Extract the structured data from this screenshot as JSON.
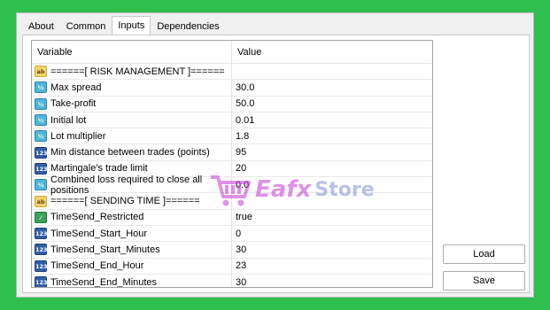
{
  "tabs": [
    {
      "label": "About"
    },
    {
      "label": "Common"
    },
    {
      "label": "Inputs"
    },
    {
      "label": "Dependencies"
    }
  ],
  "active_tab": "Inputs",
  "grid": {
    "columns": {
      "variable": "Variable",
      "value": "Value"
    },
    "rows": [
      {
        "icon": "ab-icon",
        "variable": "======[ RISK MANAGEMENT ]======",
        "value": ""
      },
      {
        "icon": "double-icon",
        "variable": "Max spread",
        "value": "30.0"
      },
      {
        "icon": "double-icon",
        "variable": "Take-profit",
        "value": "50.0"
      },
      {
        "icon": "double-icon",
        "variable": "Initial lot",
        "value": "0.01"
      },
      {
        "icon": "double-icon",
        "variable": "Lot multiplier",
        "value": "1.8"
      },
      {
        "icon": "integer-icon",
        "variable": "Min distance between trades (points)",
        "value": "95"
      },
      {
        "icon": "integer-icon",
        "variable": "Martingale's trade limit",
        "value": "20"
      },
      {
        "icon": "double-icon",
        "variable": "Combined loss required to close all positions",
        "value": "0.0"
      },
      {
        "icon": "ab-icon",
        "variable": "======[ SENDING TIME ]======",
        "value": ""
      },
      {
        "icon": "bool-icon",
        "variable": "TimeSend_Restricted",
        "value": "true"
      },
      {
        "icon": "integer-icon",
        "variable": "TimeSend_Start_Hour",
        "value": "0"
      },
      {
        "icon": "integer-icon",
        "variable": "TimeSend_Start_Minutes",
        "value": "30"
      },
      {
        "icon": "integer-icon",
        "variable": "TimeSend_End_Hour",
        "value": "23"
      },
      {
        "icon": "integer-icon",
        "variable": "TimeSend_End_Minutes",
        "value": "30"
      }
    ]
  },
  "buttons": {
    "load": "Load",
    "save": "Save"
  },
  "watermark": {
    "brand": "Eafx",
    "store": "Store"
  },
  "colors": {
    "background": "#2fbf4f",
    "watermark_brand": "#c43ad0",
    "watermark_store": "#7b8fd8"
  }
}
